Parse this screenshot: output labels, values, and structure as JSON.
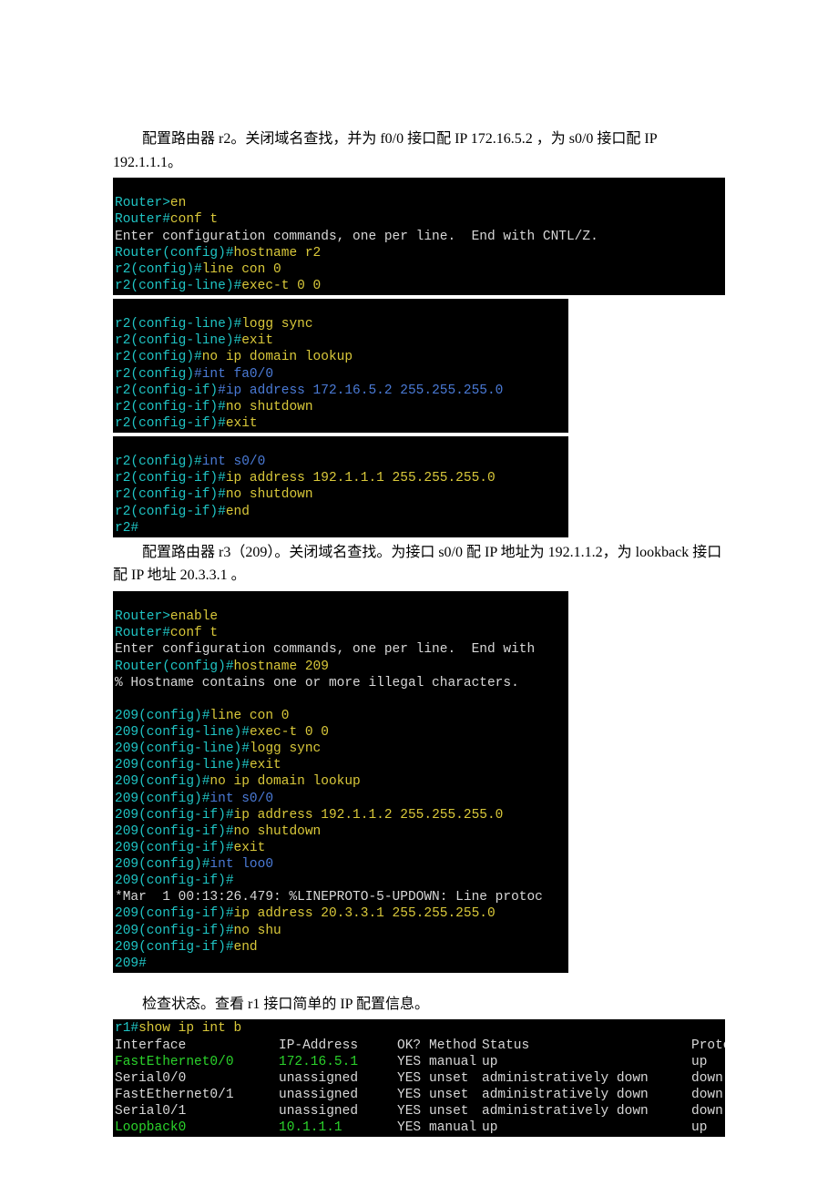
{
  "para1": "配置路由器 r2。关闭域名查找，并为 f0/0 接口配 IP 172.16.5.2 ，为 s0/0 接口配 IP 192.1.1.1。",
  "term1": {
    "l1a": "Router>",
    "l1b": "en",
    "l2a": "Router#",
    "l2b": "conf t",
    "l3": "Enter configuration commands, one per line.  End with CNTL/Z.",
    "l4a": "Router(config)#",
    "l4b": "hostname r2",
    "l5a": "r2(config)#",
    "l5b": "line con 0",
    "l6a": "r2(config-line)#",
    "l6b": "exec-t 0 0"
  },
  "term2": {
    "l1a": "r2(config-line)#",
    "l1b": "logg sync",
    "l2a": "r2(config-line)#",
    "l2b": "exit",
    "l3a": "r2(config)#",
    "l3b": "no ip domain lookup",
    "l4a": "r2(config)",
    "l4b": "#int fa0/0",
    "l5a": "r2(config-if)",
    "l5b": "#ip address 172.16.5.2 255.255.255.0",
    "l6a": "r2(config-if)#",
    "l6b": "no shutdown",
    "l7a": "r2(config-if)#",
    "l7b": "exit"
  },
  "term3": {
    "l1a": "r2(config)#",
    "l1b": "int s0/0",
    "l2a": "r2(config-if)#",
    "l2b": "ip address 192.1.1.1 255.255.255.0",
    "l3a": "r2(config-if)#",
    "l3b": "no shutdown",
    "l4a": "r2(config-if)#",
    "l4b": "end",
    "l5": "r2#"
  },
  "para2": "配置路由器 r3（209）。关闭域名查找。为接口 s0/0 配 IP 地址为 192.1.1.2，为 lookback 接口配 IP 地址 20.3.3.1 。",
  "term4": {
    "l1a": "Router>",
    "l1b": "enable",
    "l2a": "Router#",
    "l2b": "conf t",
    "l3": "Enter configuration commands, one per line.  End with",
    "l4a": "Router(config)#",
    "l4b": "hostname 209",
    "l5": "% Hostname contains one or more illegal characters.",
    "l6": " ",
    "l7a": "209(config)#",
    "l7b": "line con 0",
    "l8a": "209(config-line)#",
    "l8b": "exec-t 0 0",
    "l9a": "209(config-line)#",
    "l9b": "logg sync",
    "l10a": "209(config-line)#",
    "l10b": "exit",
    "l11a": "209(config)#",
    "l11b": "no ip domain lookup",
    "l12a": "209(config)#",
    "l12b": "int s0/0",
    "l13a": "209(config-if)#",
    "l13b": "ip address 192.1.1.2 255.255.255.0",
    "l14a": "209(config-if)#",
    "l14b": "no shutdown",
    "l15a": "209(config-if)#",
    "l15b": "exit",
    "l16a": "209(config)#",
    "l16b": "int loo0",
    "l17": "209(config-if)#",
    "l18": "*Mar  1 00:13:26.479: %LINEPROTO-5-UPDOWN: Line protoc",
    "l19a": "209(config-if)#",
    "l19b": "ip address 20.3.3.1 255.255.255.0",
    "l20a": "209(config-if)#",
    "l20b": "no shu",
    "l21a": "209(config-if)#",
    "l21b": "end",
    "l22": "209#"
  },
  "para3": "检查状态。查看 r1 接口简单的 IP 配置信息。",
  "term5": {
    "cmd_a": "r1#",
    "cmd_b": "show ip int b",
    "hdr": {
      "iface": "Interface",
      "ip": "IP-Address",
      "ok": "OK?",
      "method": "Method",
      "status": "Status",
      "proto": "Protocol"
    },
    "rows": [
      {
        "iface": "FastEthernet0/0",
        "ip": "172.16.5.1",
        "ok": "YES",
        "method": "manual",
        "status": "up",
        "proto": "up",
        "hl": true
      },
      {
        "iface": "Serial0/0",
        "ip": "unassigned",
        "ok": "YES",
        "method": "unset",
        "status": "administratively down",
        "proto": "down",
        "hl": false
      },
      {
        "iface": "FastEthernet0/1",
        "ip": "unassigned",
        "ok": "YES",
        "method": "unset",
        "status": "administratively down",
        "proto": "down",
        "hl": false
      },
      {
        "iface": "Serial0/1",
        "ip": "unassigned",
        "ok": "YES",
        "method": "unset",
        "status": "administratively down",
        "proto": "down",
        "hl": false
      },
      {
        "iface": "Loopback0",
        "ip": "10.1.1.1",
        "ok": "YES",
        "method": "manual",
        "status": "up",
        "proto": "up",
        "hl": true
      }
    ]
  }
}
